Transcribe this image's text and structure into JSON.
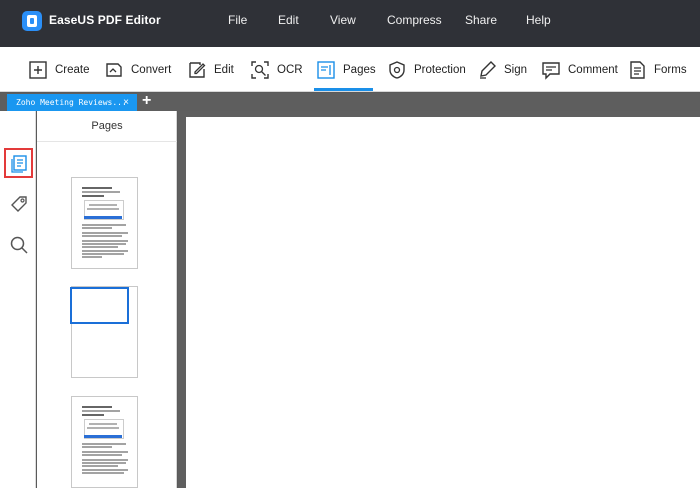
{
  "app": {
    "title": "EaseUS PDF Editor",
    "menu": [
      "File",
      "Edit",
      "View",
      "Compress",
      "Share",
      "Help"
    ]
  },
  "toolbar": {
    "create": "Create",
    "convert": "Convert",
    "edit": "Edit",
    "ocr": "OCR",
    "pages": "Pages",
    "protection": "Protection",
    "sign": "Sign",
    "comment": "Comment",
    "forms": "Forms"
  },
  "tabs": {
    "doc_title": "Zoho Meeting Reviews...",
    "close": "×",
    "add": "+"
  },
  "sidebar": {
    "panel_title": "Pages"
  },
  "colors": {
    "titlebar": "#2f3137",
    "accent": "#1a8fe8",
    "highlight": "#e33a3a"
  }
}
